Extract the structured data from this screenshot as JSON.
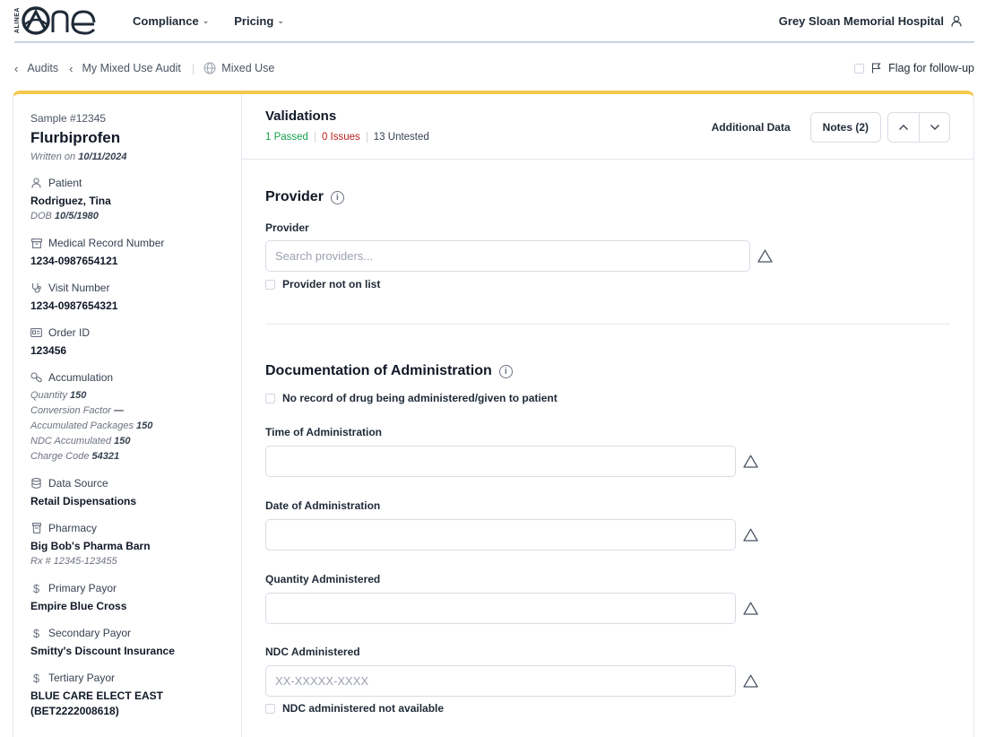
{
  "logo": {
    "brand_vertical": "ALINEA",
    "brand": "ONE"
  },
  "nav": {
    "compliance": "Compliance",
    "pricing": "Pricing",
    "hospital": "Grey Sloan Memorial Hospital"
  },
  "breadcrumb": {
    "audits": "Audits",
    "audit": "My Mixed Use Audit",
    "current": "Mixed Use",
    "flag": "Flag for follow-up"
  },
  "sample": {
    "number": "Sample #12345",
    "drug": "Flurbiprofen",
    "written_prefix": "Written on",
    "written_date": "10/11/2024",
    "patient": {
      "label": "Patient",
      "name": "Rodriguez, Tina",
      "dob_label": "DOB",
      "dob": "10/5/1980"
    },
    "mrn": {
      "label": "Medical Record Number",
      "value": "1234-0987654121"
    },
    "visit": {
      "label": "Visit Number",
      "value": "1234-0987654321"
    },
    "order": {
      "label": "Order ID",
      "value": "123456"
    },
    "accumulation": {
      "label": "Accumulation",
      "quantity_label": "Quantity",
      "quantity": "150",
      "conversion_label": "Conversion Factor",
      "conversion": "—",
      "packages_label": "Accumulated Packages",
      "packages": "150",
      "ndc_label": "NDC Accumulated",
      "ndc": "150",
      "charge_label": "Charge Code",
      "charge": "54321"
    },
    "data_source": {
      "label": "Data Source",
      "value": "Retail Dispensations"
    },
    "pharmacy": {
      "label": "Pharmacy",
      "value": "Big Bob's Pharma Barn",
      "rx": "Rx # 12345-123455"
    },
    "primary_payor": {
      "label": "Primary Payor",
      "value": "Empire Blue Cross"
    },
    "secondary_payor": {
      "label": "Secondary Payor",
      "value": "Smitty's Discount Insurance"
    },
    "tertiary_payor": {
      "label": "Tertiary Payor",
      "value": "BLUE CARE ELECT EAST",
      "value2": "(BET2222008618)"
    }
  },
  "validations": {
    "title": "Validations",
    "passed": "1 Passed",
    "issues": "0 Issues",
    "untested": "13 Untested",
    "additional_data": "Additional Data",
    "notes": "Notes (2)"
  },
  "provider_section": {
    "title": "Provider",
    "field_label": "Provider",
    "placeholder": "Search providers...",
    "not_on_list": "Provider not on list"
  },
  "admin_section": {
    "title": "Documentation of Administration",
    "no_record": "No record of drug being administered/given to patient",
    "time_label": "Time of Administration",
    "date_label": "Date of Administration",
    "qty_label": "Quantity Administered",
    "ndc_label": "NDC Administered",
    "ndc_placeholder": "XX-XXXXX-XXXX",
    "ndc_na": "NDC administered not available"
  },
  "colors": {
    "accent_top": "#f5c84c",
    "passed": "#16a34a",
    "issues": "#b91c1c"
  }
}
